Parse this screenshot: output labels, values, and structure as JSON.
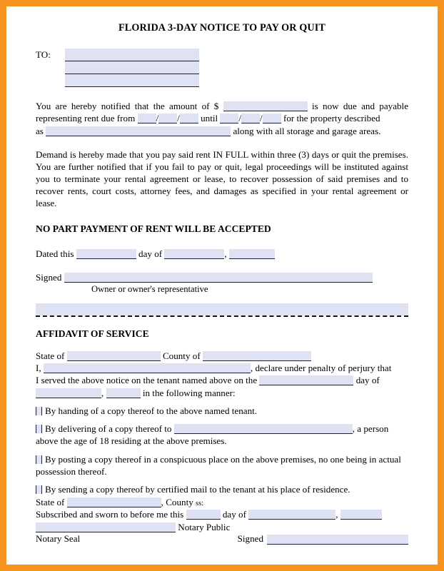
{
  "frame": {
    "border_color": "#f5931e",
    "sheet_color": "#ffffff",
    "field_fill": "#dfe2f3",
    "field_rule": "#1a1f3d"
  },
  "title": "FLORIDA 3-DAY NOTICE TO PAY OR QUIT",
  "to_block": {
    "label": "TO:",
    "lines": [
      "",
      "",
      ""
    ]
  },
  "notice": {
    "p1_a": "You are hereby notified that the amount of $",
    "p1_amount": "",
    "p1_b": "is now due and payable representing rent due from",
    "p1_from": {
      "month": "",
      "day": "",
      "year": ""
    },
    "p1_until_label": "until",
    "p1_until": {
      "month": "",
      "day": "",
      "year": ""
    },
    "p1_c": "for the property described",
    "p1_as_label": "as",
    "p1_property": "",
    "p1_d": "along with all storage and garage areas.",
    "p2": "Demand is hereby made that you pay said rent IN FULL within three (3) days or quit the premises.  You are further notified that if you fail to pay or quit, legal proceedings will be instituted against you to terminate your rental agreement or lease, to recover possession of said premises and to recover rents, court costs, attorney fees, and damages as specified in your rental agreement or lease."
  },
  "no_part_payment_heading": "NO PART PAYMENT OF RENT WILL BE ACCEPTED",
  "dated": {
    "prefix": "Dated this",
    "day_value": "",
    "mid": "day of",
    "month_value": "",
    "comma": ",",
    "year_value": ""
  },
  "signed": {
    "label": "Signed",
    "value": "",
    "caption": "Owner or owner's representative"
  },
  "affidavit": {
    "heading": "AFFIDAVIT OF SERVICE",
    "state_label": "State of",
    "state_value": "",
    "county_label": "County of",
    "county_value": "",
    "i_label": "I,",
    "affiant_value": "",
    "declare_text": ", declare under penalty of perjury that",
    "served_text": "I served the above notice on the tenant named above on the",
    "served_day": "",
    "day_of_label": "day of",
    "served_month": "",
    "served_comma": ",",
    "served_year": "",
    "manner_text": "in the following manner:",
    "methods": [
      {
        "text_before": "By handing of a copy thereof to the above named tenant.",
        "field": null,
        "text_after": ""
      },
      {
        "text_before": "By delivering of a copy thereof to",
        "field": "",
        "text_after": ", a person above the age of 18 residing at the above premises."
      },
      {
        "text_before": "By posting a copy thereof in a conspicuous place on the above premises, no one being in actual possession thereof.",
        "field": null,
        "text_after": ""
      },
      {
        "text_before": "By sending a copy thereof by certified mail to the tenant at his place of residence.",
        "field": null,
        "text_after": ""
      }
    ]
  },
  "notary": {
    "state_label": "State of",
    "state_value": "",
    "county_ss": ", County",
    "ss": "ss:",
    "sworn_text": "Subscribed and sworn to before me this",
    "sworn_day": "",
    "day_of_label": "day of",
    "sworn_month": "",
    "comma": ",",
    "sworn_year": "",
    "notary_line_value": "",
    "notary_public_label": "Notary Public",
    "seal_label": "Notary Seal",
    "signed_label": "Signed",
    "signed_value": ""
  }
}
